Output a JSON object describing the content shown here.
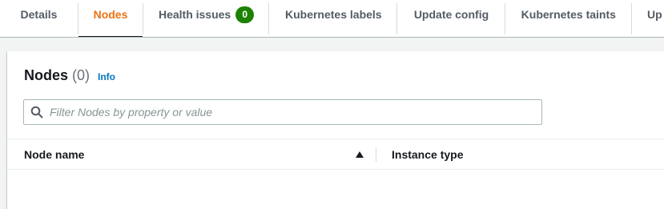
{
  "tabs": [
    {
      "label": "Details",
      "active": false
    },
    {
      "label": "Nodes",
      "active": true
    },
    {
      "label": "Health issues",
      "active": false,
      "badge": "0"
    },
    {
      "label": "Kubernetes labels",
      "active": false
    },
    {
      "label": "Update config",
      "active": false
    },
    {
      "label": "Kubernetes taints",
      "active": false
    },
    {
      "label": "Up",
      "active": false
    }
  ],
  "panel": {
    "title": "Nodes",
    "count": "(0)",
    "info_link": "Info",
    "filter_placeholder": "Filter Nodes by property or value"
  },
  "table": {
    "columns": [
      "Node name",
      "Instance type"
    ],
    "sort_icon": "sort-ascending-icon"
  },
  "colors": {
    "active_tab": "#ec7211",
    "badge_bg": "#1d8102",
    "link": "#0073bb",
    "text": "#16191f",
    "muted_text": "#545b64"
  }
}
